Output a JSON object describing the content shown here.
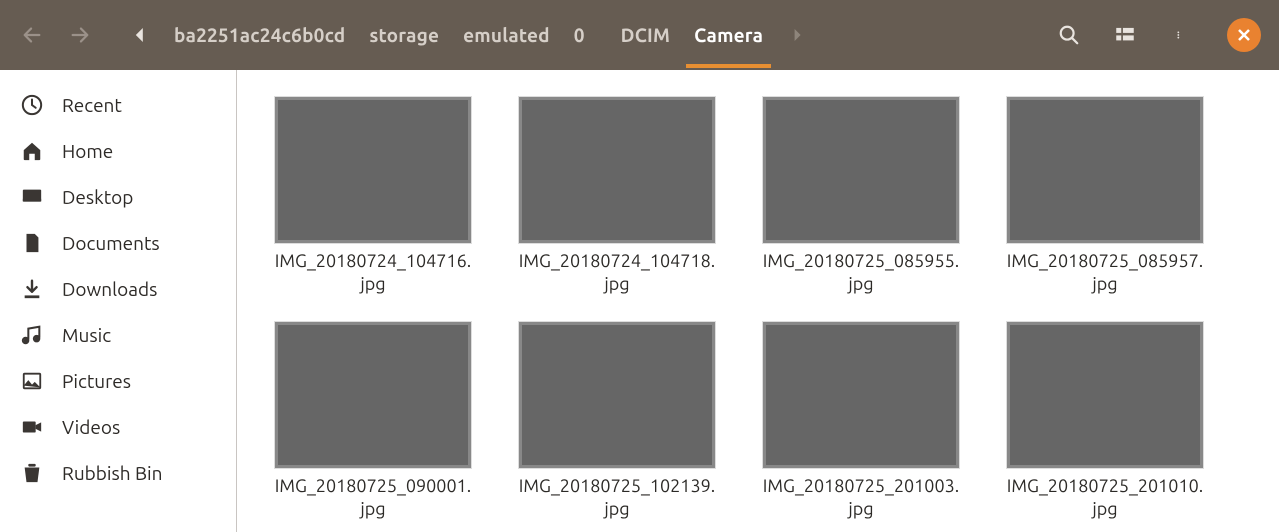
{
  "breadcrumbs": [
    {
      "label": "ba2251ac24c6b0cd"
    },
    {
      "label": "storage"
    },
    {
      "label": "emulated"
    },
    {
      "label": "0"
    },
    {
      "label": "DCIM"
    },
    {
      "label": "Camera",
      "active": true
    }
  ],
  "sidebar": [
    {
      "icon": "recent",
      "label": "Recent"
    },
    {
      "icon": "home",
      "label": "Home"
    },
    {
      "icon": "desktop",
      "label": "Desktop"
    },
    {
      "icon": "documents",
      "label": "Documents"
    },
    {
      "icon": "downloads",
      "label": "Downloads"
    },
    {
      "icon": "music",
      "label": "Music"
    },
    {
      "icon": "pictures",
      "label": "Pictures"
    },
    {
      "icon": "videos",
      "label": "Videos"
    },
    {
      "icon": "trash",
      "label": "Rubbish Bin"
    }
  ],
  "files": [
    {
      "name_l1": "IMG_20180724_104716.",
      "name_l2": "jpg",
      "thumb": "th-dog"
    },
    {
      "name_l1": "IMG_20180724_104718.",
      "name_l2": "jpg",
      "thumb": "th-dog"
    },
    {
      "name_l1": "IMG_20180725_085955.",
      "name_l2": "jpg",
      "thumb": "th-carplay"
    },
    {
      "name_l1": "IMG_20180725_085957.",
      "name_l2": "jpg",
      "thumb": "th-carplay2"
    },
    {
      "name_l1": "IMG_20180725_090001.",
      "name_l2": "jpg",
      "thumb": "th-carplay"
    },
    {
      "name_l1": "IMG_20180725_102139.",
      "name_l2": "jpg",
      "thumb": "th-laptop"
    },
    {
      "name_l1": "IMG_20180725_201003.",
      "name_l2": "jpg",
      "thumb": "th-monitor"
    },
    {
      "name_l1": "IMG_20180725_201010.",
      "name_l2": "jpg",
      "thumb": "th-monitor"
    }
  ]
}
